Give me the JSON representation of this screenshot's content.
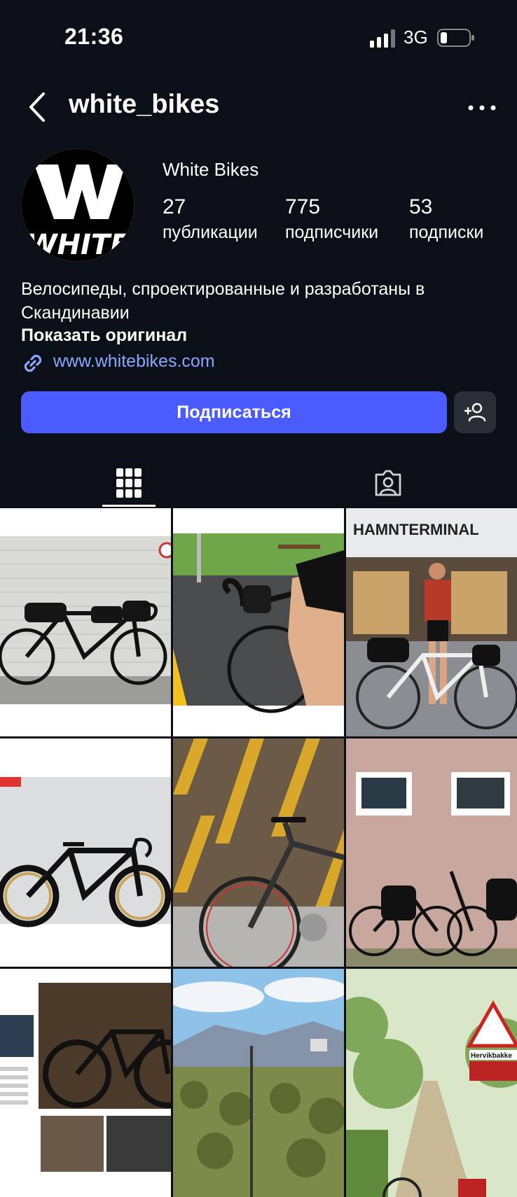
{
  "status": {
    "time": "21:36",
    "network": "3G"
  },
  "header": {
    "username": "white_bikes"
  },
  "profile": {
    "avatar_text": "W",
    "avatar_subtext": "WHITE",
    "display_name": "White Bikes",
    "stats": [
      {
        "value": "27",
        "label": "публикации"
      },
      {
        "value": "775",
        "label": "подписчики"
      },
      {
        "value": "53",
        "label": "подписки"
      }
    ],
    "bio": "Велосипеды, спроектированные и разработаны в Скандинавии",
    "show_original": "Показать оригинал",
    "website": "www.whitebikes.com",
    "follow_label": "Подписаться"
  },
  "posts": [
    {
      "caption": "",
      "sign": ""
    },
    {
      "caption": "",
      "sign": ""
    },
    {
      "caption": "",
      "sign": "HAMNTERMINAL"
    },
    {
      "caption": "",
      "sign": ""
    },
    {
      "caption": "",
      "sign": ""
    },
    {
      "caption": "",
      "sign": ""
    },
    {
      "caption": "",
      "sign": ""
    },
    {
      "caption": "",
      "sign": ""
    },
    {
      "caption": "",
      "sign": "Hervikbakke"
    }
  ],
  "colors": {
    "accent": "#4a5cff",
    "link": "#8aa8ff",
    "background": "#0b0f17"
  }
}
